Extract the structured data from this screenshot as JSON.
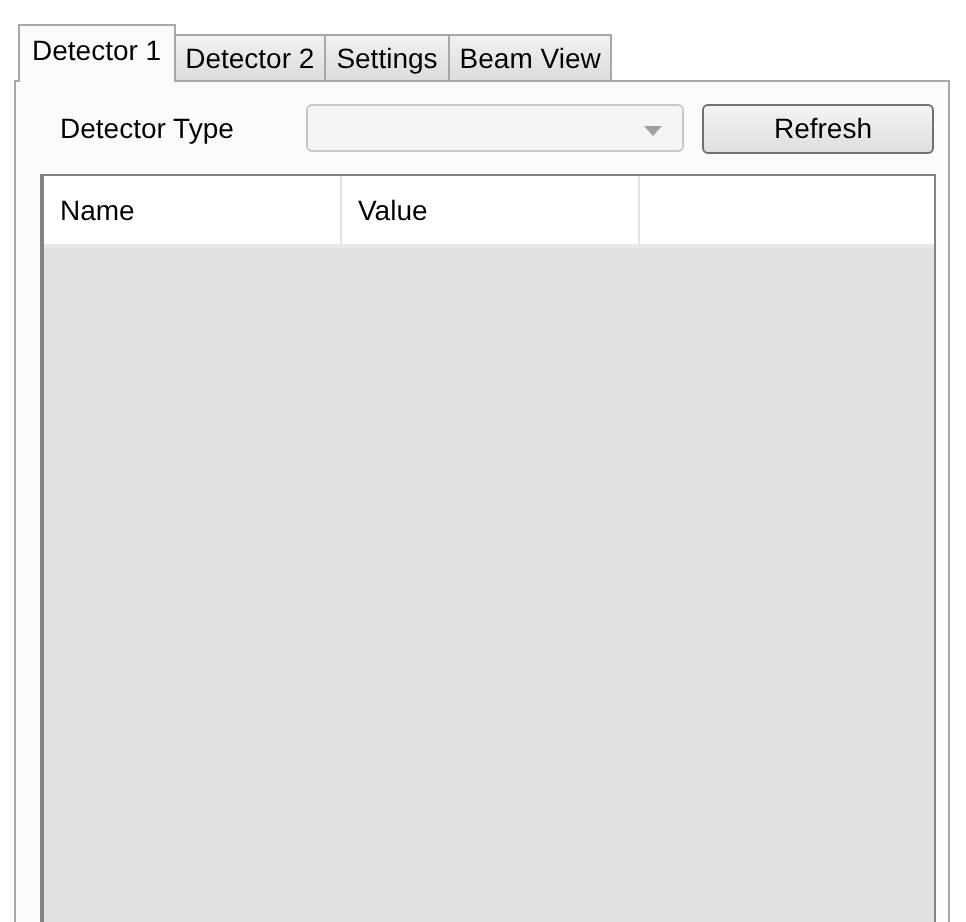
{
  "tabs": [
    {
      "label": "Detector 1",
      "selected": true
    },
    {
      "label": "Detector 2",
      "selected": false
    },
    {
      "label": "Settings",
      "selected": false
    },
    {
      "label": "Beam View",
      "selected": false
    }
  ],
  "detector_type": {
    "label": "Detector Type",
    "disabled": true
  },
  "refresh_button": "Refresh",
  "table": {
    "columns": [
      "Name",
      "Value"
    ]
  }
}
